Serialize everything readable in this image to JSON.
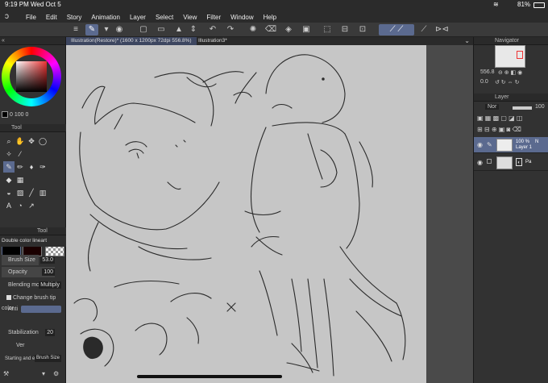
{
  "status": {
    "time": "9:19 PM",
    "date": "Wed Oct 5",
    "battery": "81%"
  },
  "menu": [
    "File",
    "Edit",
    "Story",
    "Animation",
    "Layer",
    "Select",
    "View",
    "Filter",
    "Window",
    "Help"
  ],
  "tabs": [
    {
      "label": "Illustration(Restore)* (1600 x 1200px 72dpi 556.8%)",
      "active": true
    },
    {
      "label": "Illustration3*",
      "active": false
    }
  ],
  "left": {
    "color_values": [
      "0",
      "100",
      "0"
    ],
    "tool_panel_title": "Tool",
    "sub_tool_panel_title": "Tool",
    "sub_tool_name": "Double color lineart",
    "brush_size": {
      "label": "Brush Size",
      "value": "53.0",
      "fraction": 0.7
    },
    "opacity": {
      "label": "Opacity",
      "value": "100",
      "fraction": 1.0
    },
    "blending": {
      "label": "Blending mod",
      "value": "Multiply"
    },
    "change_color": "Change brush tip color",
    "anti": "Anti",
    "stabilization": {
      "label": "Stabilization",
      "value": "20"
    },
    "ver_label": "Ver",
    "starting": "Starting and e",
    "starting_value": "Brush Size"
  },
  "right": {
    "navigator_title": "Navigator",
    "zoom": "556.8",
    "angle": "0.0",
    "layer_tab": "Layer",
    "blend_mode": "Nor",
    "opacity": "100",
    "layers": [
      {
        "opacity": "100 %",
        "mode": "N",
        "name": "Layer 1",
        "selected": true
      },
      {
        "name": "Pa",
        "selected": false
      }
    ]
  },
  "colors": {
    "accent": "#5b6a8f",
    "panel": "#323232",
    "paper": "#c6c6c6"
  }
}
